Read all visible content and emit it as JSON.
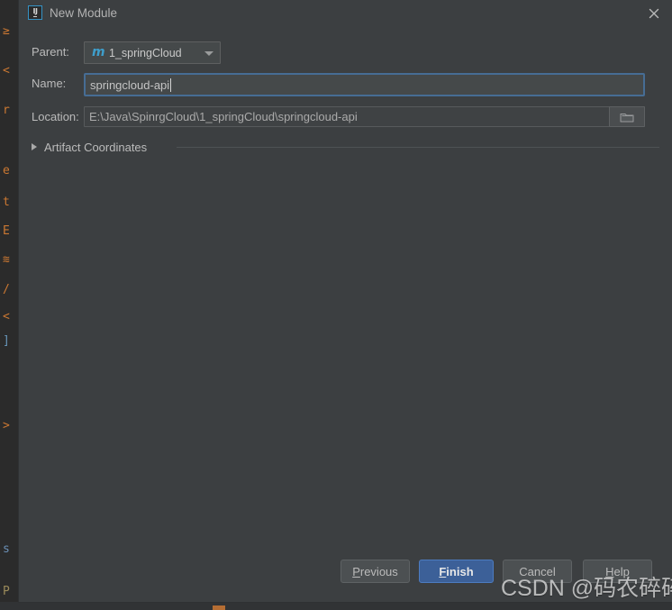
{
  "window": {
    "title": "New Module",
    "app_icon": "IJ",
    "close_icon": "close-icon"
  },
  "form": {
    "parent": {
      "label": "Parent:",
      "value": "1_springCloud",
      "icon": "maven-module-icon",
      "icon_glyph": "m",
      "arrow_icon": "chevron-down-icon"
    },
    "name": {
      "label": "Name:",
      "value": "springcloud-api",
      "placeholder": ""
    },
    "location": {
      "label": "Location:",
      "value": "E:\\Java\\SpinrgCloud\\1_springCloud\\springcloud-api",
      "placeholder": "",
      "browse_icon": "folder-icon"
    },
    "artifact_coordinates": {
      "label": "Artifact Coordinates",
      "expanded": false,
      "arrow_icon": "chevron-right-icon"
    }
  },
  "footer": {
    "buttons": [
      {
        "name": "previous-button",
        "label": "Previous",
        "mnemonic": "P",
        "primary": false
      },
      {
        "name": "finish-button",
        "label": "Finish",
        "mnemonic": "F",
        "primary": true
      },
      {
        "name": "cancel-button",
        "label": "Cancel",
        "mnemonic": "",
        "primary": false
      },
      {
        "name": "help-button",
        "label": "Help",
        "mnemonic": "H",
        "primary": false
      }
    ],
    "previous_pre": "",
    "previous_mn": "P",
    "previous_post": "revious",
    "finish_pre": "",
    "finish_mn": "F",
    "finish_post": "inish",
    "cancel_text": "Cancel",
    "help_pre": "",
    "help_mn": "H",
    "help_post": "elp"
  },
  "watermark": {
    "text": "CSDN @码农碎碎念"
  },
  "background": {
    "gutter_chars": [
      "≥",
      "<",
      "r",
      "e",
      "t",
      "E",
      "≋",
      "/",
      "<",
      "]",
      ">",
      "s",
      "P"
    ],
    "colors": {
      "editor_bg": "#2b2b2b",
      "dialog_bg": "#3c3f41",
      "accent_blue": "#3c6098",
      "focus_blue": "#466d94",
      "maven_blue": "#3e9ecb"
    }
  }
}
